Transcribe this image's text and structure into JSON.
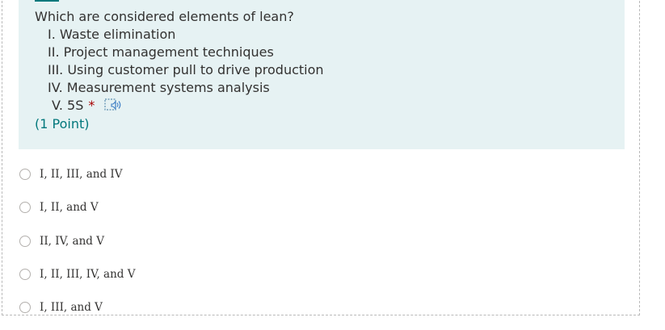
{
  "question": {
    "title": "Which are considered elements of lean?",
    "items": [
      "I. Waste elimination",
      "II. Project management techniques",
      "III. Using customer pull to drive production",
      "IV. Measurement systems analysis",
      "V. 5S"
    ],
    "required_mark": "*",
    "speaker_icon": "immersive-reader-icon",
    "points": "(1 Point)"
  },
  "options": [
    "I, II, III, and IV",
    "I, II, and V",
    "II, IV, and V",
    "I, II, III, IV, and V",
    "I, III, and V"
  ],
  "colors": {
    "question_bg": "#e6f2f3",
    "accent": "#03787c",
    "required": "#a80000"
  }
}
